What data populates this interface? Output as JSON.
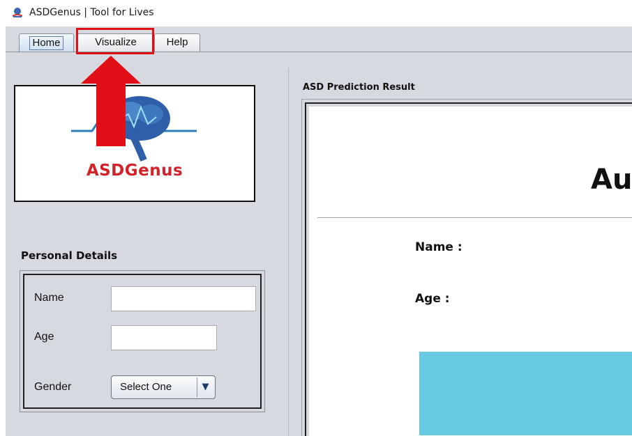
{
  "window": {
    "title": "ASDGenus | Tool for Lives",
    "icon": "app-logo-icon"
  },
  "tabs": [
    {
      "label": "Home",
      "selected": true
    },
    {
      "label": "Visualize",
      "selected": false,
      "highlighted": true
    },
    {
      "label": "Help",
      "selected": false
    }
  ],
  "annotation": {
    "arrow_color": "#e01016",
    "highlight_color": "#e01016"
  },
  "logo": {
    "text": "ASDGenus",
    "icon": "brain-icon",
    "text_color": "#d42229"
  },
  "personal_details": {
    "title": "Personal Details",
    "name_label": "Name",
    "name_value": "",
    "age_label": "Age",
    "age_value": "",
    "gender_label": "Gender",
    "gender_selected": "Select One",
    "dropdown_icon": "chevron-down-icon"
  },
  "result": {
    "title": "ASD Prediction Result",
    "heading_partial": "Au",
    "name_label": "Name :",
    "age_label": "Age :",
    "block_color": "#66cbe0"
  }
}
